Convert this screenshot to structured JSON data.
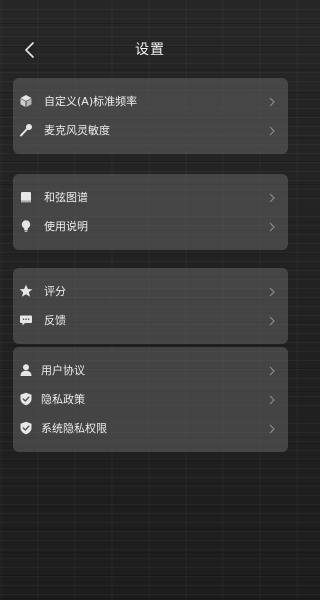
{
  "header": {
    "title": "设置",
    "back_icon": "back-arrow-icon"
  },
  "colors": {
    "background": "#232323",
    "card": "#5f5f5f",
    "text": "#ededed",
    "icon": "#e6e6e6",
    "chevron": "#8a8a8a"
  },
  "groups": [
    {
      "items": [
        {
          "label": "自定义(A)标准频率",
          "icon": "cube-icon"
        },
        {
          "label": "麦克风灵敏度",
          "icon": "microphone-icon"
        }
      ]
    },
    {
      "items": [
        {
          "label": "和弦图谱",
          "icon": "book-icon"
        },
        {
          "label": "使用说明",
          "icon": "lightbulb-icon"
        }
      ]
    },
    {
      "items": [
        {
          "label": "评分",
          "icon": "star-icon"
        },
        {
          "label": "反馈",
          "icon": "chat-bubble-icon"
        }
      ]
    },
    {
      "items": [
        {
          "label": "用户协议",
          "icon": "user-icon"
        },
        {
          "label": "隐私政策",
          "icon": "shield-check-icon"
        },
        {
          "label": "系统隐私权限",
          "icon": "shield-check-icon"
        }
      ]
    }
  ]
}
